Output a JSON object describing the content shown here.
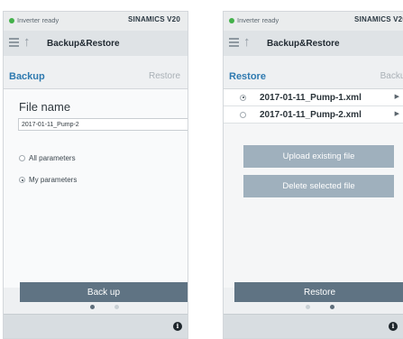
{
  "status": {
    "ready_text": "Inverter ready",
    "brand": "SINAMICS V20",
    "indicator_color": "#43b14a"
  },
  "backup_screen": {
    "title": "Backup&Restore",
    "tabs": {
      "active": "Backup",
      "inactive": "Restore"
    },
    "file_name_label": "File name",
    "file_name_value": "2017-01-11_Pump-2",
    "options": [
      {
        "label": "All parameters",
        "selected": false
      },
      {
        "label": "My parameters",
        "selected": true
      }
    ],
    "action_button": "Back up",
    "page_indicator": {
      "current": 1,
      "total": 2
    },
    "info_icon": "i"
  },
  "restore_screen": {
    "title": "Backup&Restore",
    "tabs": {
      "active": "Restore",
      "inactive": "Backup"
    },
    "files": [
      {
        "name": "2017-01-11_Pump-1.xml",
        "selected": true
      },
      {
        "name": "2017-01-11_Pump-2.xml",
        "selected": false
      }
    ],
    "upload_button": "Upload existing file",
    "delete_button": "Delete selected file",
    "action_button": "Restore",
    "page_indicator": {
      "current": 2,
      "total": 2
    },
    "info_icon": "i"
  },
  "colors": {
    "accent": "#2f7ab0",
    "primary_button": "#5f7383",
    "secondary_button": "#9fb0bd"
  }
}
